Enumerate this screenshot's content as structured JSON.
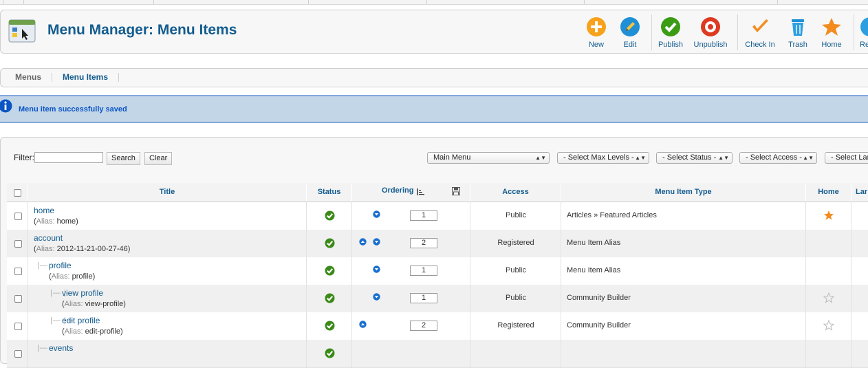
{
  "header": {
    "title": "Menu Manager: Menu Items"
  },
  "toolbar": {
    "buttons": [
      {
        "label": "New",
        "icon": "plus-icon",
        "color": "#f7a21b"
      },
      {
        "label": "Edit",
        "icon": "pencil-icon",
        "color": "#1f8fd6"
      },
      {
        "label": "Publish",
        "icon": "check-icon",
        "color": "#3b9c14"
      },
      {
        "label": "Unpublish",
        "icon": "stop-icon",
        "color": "#dd3a22"
      },
      {
        "label": "Check In",
        "icon": "checkmark-icon",
        "color": "#f28c1f"
      },
      {
        "label": "Trash",
        "icon": "trash-icon",
        "color": "#2d9fe0"
      },
      {
        "label": "Home",
        "icon": "star-icon",
        "color": "#f28c1f"
      },
      {
        "label": "Re",
        "icon": "rebuild-icon",
        "color": "#2d9fe0"
      }
    ]
  },
  "submenu": {
    "items": [
      "Menus",
      "Menu Items"
    ],
    "active": "Menu Items"
  },
  "message": {
    "text": "Menu item successfully saved"
  },
  "filter": {
    "label": "Filter:",
    "value": "",
    "search_label": "Search",
    "clear_label": "Clear"
  },
  "selects": {
    "menu": "Main Menu",
    "max_levels": "- Select Max Levels -",
    "status": "- Select Status -",
    "access": "- Select Access -",
    "language": "- Select Lar"
  },
  "table": {
    "headers": {
      "title": "Title",
      "status": "Status",
      "ordering": "Ordering",
      "access": "Access",
      "type": "Menu Item Type",
      "home": "Home",
      "language": "Lar"
    },
    "alias_label": "Alias:",
    "rows": [
      {
        "title": "home",
        "alias": "home",
        "level": 1,
        "published": true,
        "up": false,
        "down": true,
        "order": "1",
        "access": "Public",
        "type": "Articles » Featured Articles",
        "home": "default"
      },
      {
        "title": "account",
        "alias": "2012-11-21-00-27-46",
        "level": 1,
        "published": true,
        "up": true,
        "down": true,
        "order": "2",
        "access": "Registered",
        "type": "Menu Item Alias",
        "home": "none"
      },
      {
        "title": "profile",
        "alias": "profile",
        "level": 2,
        "published": true,
        "up": false,
        "down": true,
        "order": "1",
        "access": "Public",
        "type": "Menu Item Alias",
        "home": "none"
      },
      {
        "title": "view profile",
        "alias": "view-profile",
        "level": 3,
        "published": true,
        "up": false,
        "down": true,
        "order": "1",
        "access": "Public",
        "type": "Community Builder",
        "home": "empty"
      },
      {
        "title": "edit profile",
        "alias": "edit-profile",
        "level": 3,
        "published": true,
        "up": true,
        "down": false,
        "order": "2",
        "access": "Registered",
        "type": "Community Builder",
        "home": "empty"
      },
      {
        "title": "events",
        "alias": "",
        "level": 2,
        "published": true,
        "up": false,
        "down": false,
        "order": "",
        "access": "",
        "type": "",
        "home": "none"
      }
    ]
  },
  "tree_prefix": {
    "2": "|—",
    "3": "|—  |—"
  }
}
